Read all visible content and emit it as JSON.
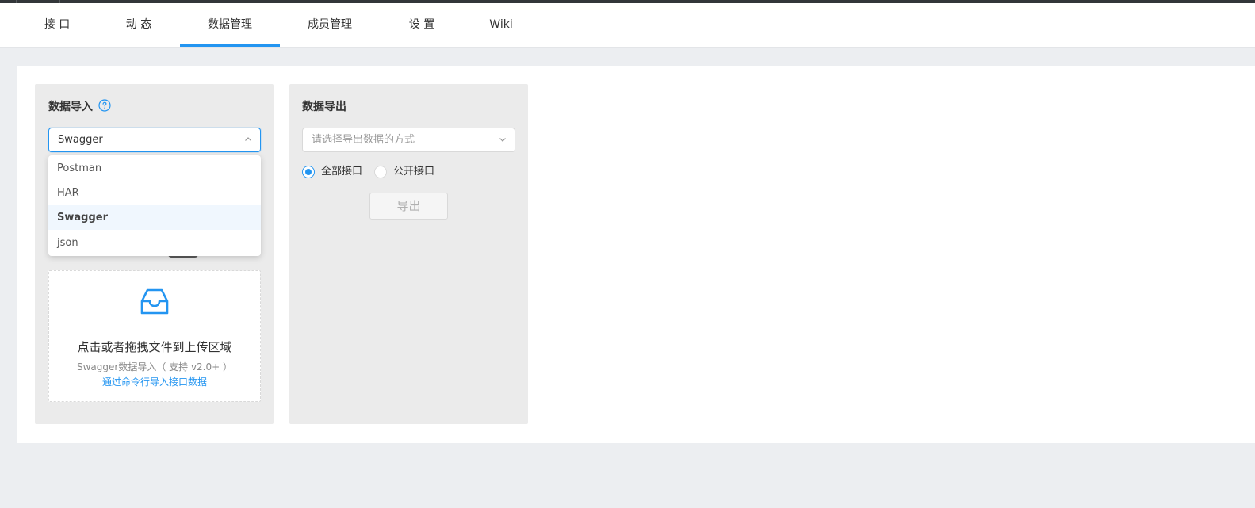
{
  "tabs": [
    {
      "label": "接 口"
    },
    {
      "label": "动 态"
    },
    {
      "label": "数据管理",
      "active": true
    },
    {
      "label": "成员管理"
    },
    {
      "label": "设 置"
    },
    {
      "label": "Wiki"
    }
  ],
  "import_panel": {
    "title": "数据导入",
    "select_value": "Swagger",
    "options": [
      "Postman",
      "HAR",
      "Swagger",
      "json"
    ],
    "selected_option": "Swagger",
    "upload": {
      "main_text": "点击或者拖拽文件到上传区域",
      "hint": "Swagger数据导入（ 支持 v2.0+ ）",
      "link": "通过命令行导入接口数据"
    }
  },
  "export_panel": {
    "title": "数据导出",
    "placeholder": "请选择导出数据的方式",
    "radios": [
      {
        "label": "全部接口",
        "checked": true
      },
      {
        "label": "公开接口",
        "checked": false
      }
    ],
    "button": "导出"
  },
  "colors": {
    "accent": "#2395f1",
    "page_bg": "#eceef1",
    "panel_bg": "#ebebeb",
    "topbar": "#32363a"
  },
  "icons": {
    "help": "question-circle-icon",
    "upload": "inbox-icon",
    "chevron_up": "chevron-up-icon",
    "chevron_down": "chevron-down-icon"
  }
}
